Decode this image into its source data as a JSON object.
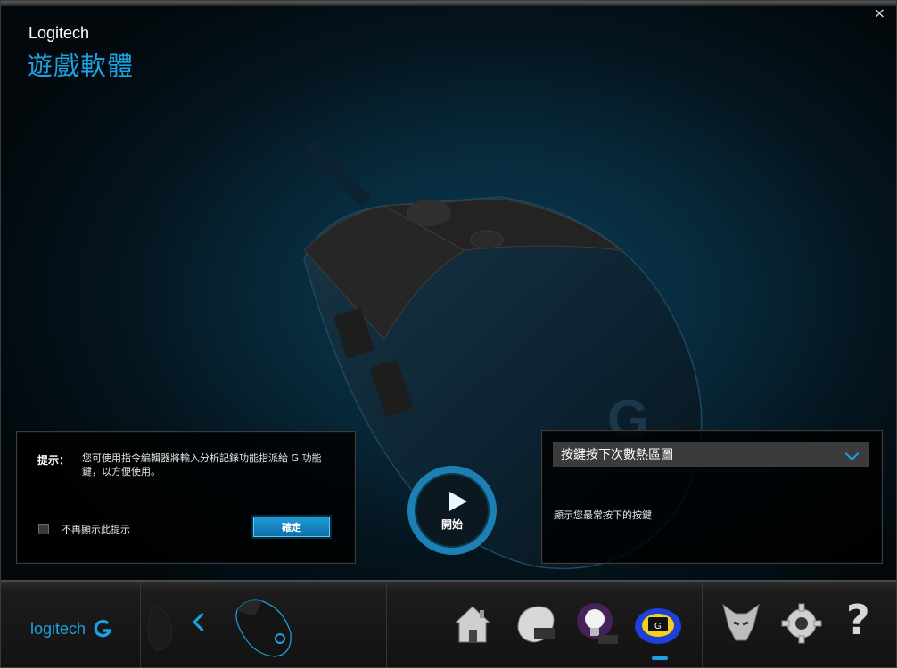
{
  "window": {
    "brand": "Logitech",
    "product": "遊戲軟體",
    "close_symbol": "×"
  },
  "tip": {
    "label": "提示：",
    "text": "您可使用指令編輯器將輸入分析記錄功能指派給 G 功能鍵，以方便使用。",
    "dont_show_label": "不再顯示此提示",
    "dont_show_checked": false,
    "ok_label": "確定"
  },
  "start": {
    "label": "開始"
  },
  "heatmap": {
    "selected": "按鍵按下次數熱區圖",
    "description": "顯示您最常按下的按鍵"
  },
  "footer": {
    "logo_text": "logitech",
    "icons": [
      "home-icon",
      "mouse-settings-icon",
      "lighting-icon",
      "heatmap-icon",
      "arx-icon",
      "settings-gear-icon",
      "help-icon"
    ],
    "help_symbol": "?",
    "active_icon": "heatmap-icon"
  },
  "colors": {
    "accent": "#1aa3e0"
  }
}
